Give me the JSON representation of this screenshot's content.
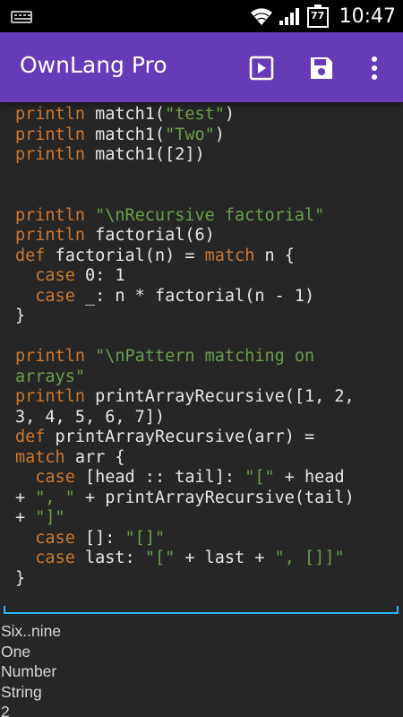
{
  "status_bar": {
    "battery_level": "77",
    "time": "10:47",
    "icons": [
      "keyboard-icon",
      "wifi-icon",
      "signal-icon",
      "battery-icon"
    ]
  },
  "app_bar": {
    "title": "OwnLang Pro",
    "actions": [
      "play-icon",
      "save-icon",
      "more-vert-icon"
    ],
    "color": "#673AB7"
  },
  "editor": {
    "lines": [
      [
        {
          "t": "println",
          "c": "kw"
        },
        {
          "t": " match1("
        },
        {
          "t": "\"test\"",
          "c": "str"
        },
        {
          "t": ")"
        }
      ],
      [
        {
          "t": "println",
          "c": "kw"
        },
        {
          "t": " match1("
        },
        {
          "t": "\"Two\"",
          "c": "str"
        },
        {
          "t": ")"
        }
      ],
      [
        {
          "t": "println",
          "c": "kw"
        },
        {
          "t": " match1([2])"
        }
      ],
      [],
      [],
      [
        {
          "t": "println",
          "c": "kw"
        },
        {
          "t": " "
        },
        {
          "t": "\"\\nRecursive factorial\"",
          "c": "str"
        }
      ],
      [
        {
          "t": "println",
          "c": "kw"
        },
        {
          "t": " factorial(6)"
        }
      ],
      [
        {
          "t": "def",
          "c": "kw"
        },
        {
          "t": " factorial(n) = "
        },
        {
          "t": "match",
          "c": "kw"
        },
        {
          "t": " n {"
        }
      ],
      [
        {
          "t": "  "
        },
        {
          "t": "case",
          "c": "kw"
        },
        {
          "t": " 0: 1"
        }
      ],
      [
        {
          "t": "  "
        },
        {
          "t": "case",
          "c": "kw"
        },
        {
          "t": " _: n * factorial(n - 1)"
        }
      ],
      [
        {
          "t": "}"
        }
      ],
      [],
      [
        {
          "t": "println",
          "c": "kw"
        },
        {
          "t": " "
        },
        {
          "t": "\"\\nPattern matching on",
          "c": "str"
        }
      ],
      [
        {
          "t": "arrays\"",
          "c": "str"
        }
      ],
      [
        {
          "t": "println",
          "c": "kw"
        },
        {
          "t": " printArrayRecursive([1, 2,"
        }
      ],
      [
        {
          "t": "3, 4, 5, 6, 7])"
        }
      ],
      [
        {
          "t": "def",
          "c": "kw"
        },
        {
          "t": " printArrayRecursive(arr) ="
        }
      ],
      [
        {
          "t": "match",
          "c": "kw"
        },
        {
          "t": " arr {"
        }
      ],
      [
        {
          "t": "  "
        },
        {
          "t": "case",
          "c": "kw"
        },
        {
          "t": " [head :: tail]: "
        },
        {
          "t": "\"[\"",
          "c": "str"
        },
        {
          "t": " + head"
        }
      ],
      [
        {
          "t": "+ "
        },
        {
          "t": "\", \"",
          "c": "str"
        },
        {
          "t": " + printArrayRecursive(tail)"
        }
      ],
      [
        {
          "t": "+ "
        },
        {
          "t": "\"]\"",
          "c": "str"
        }
      ],
      [
        {
          "t": "  "
        },
        {
          "t": "case",
          "c": "kw"
        },
        {
          "t": " []: "
        },
        {
          "t": "\"[]\"",
          "c": "str"
        }
      ],
      [
        {
          "t": "  "
        },
        {
          "t": "case",
          "c": "kw"
        },
        {
          "t": " last: "
        },
        {
          "t": "\"[\"",
          "c": "str"
        },
        {
          "t": " + last + "
        },
        {
          "t": "\", []]\"",
          "c": "str"
        }
      ],
      [
        {
          "t": "}"
        }
      ]
    ]
  },
  "output": {
    "lines": [
      "Six..nine",
      "One",
      "Number",
      "String",
      "2"
    ]
  },
  "colors": {
    "keyword": "#CC7832",
    "string": "#6A9F4C",
    "editor_bg": "#262626",
    "divider": "#29B6F6"
  }
}
